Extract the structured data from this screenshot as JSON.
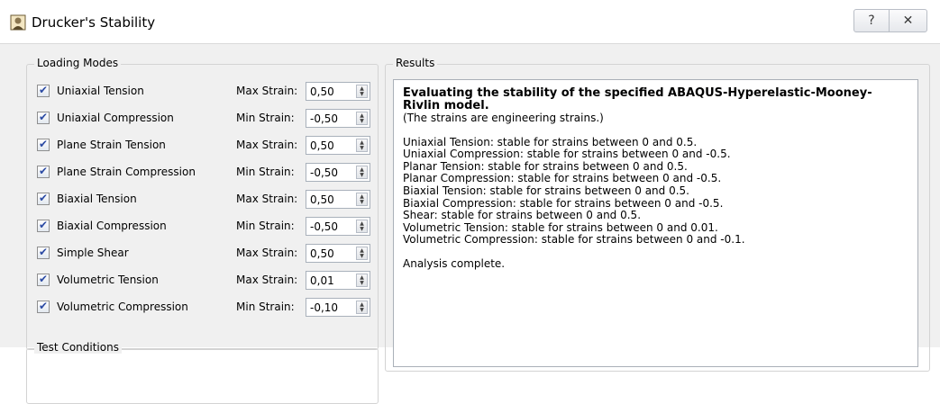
{
  "window": {
    "title": "Drucker's Stability",
    "help_label": "?",
    "close_label": "✕"
  },
  "loading_modes": {
    "title": "Loading Modes",
    "rows": [
      {
        "label": "Uniaxial Tension",
        "checked": true,
        "strain_label": "Max Strain:",
        "value": "0,50"
      },
      {
        "label": "Uniaxial Compression",
        "checked": true,
        "strain_label": "Min Strain:",
        "value": "-0,50"
      },
      {
        "label": "Plane Strain Tension",
        "checked": true,
        "strain_label": "Max Strain:",
        "value": "0,50"
      },
      {
        "label": "Plane Strain Compression",
        "checked": true,
        "strain_label": "Min Strain:",
        "value": "-0,50"
      },
      {
        "label": "Biaxial Tension",
        "checked": true,
        "strain_label": "Max Strain:",
        "value": "0,50"
      },
      {
        "label": "Biaxial Compression",
        "checked": true,
        "strain_label": "Min Strain:",
        "value": "-0,50"
      },
      {
        "label": "Simple Shear",
        "checked": true,
        "strain_label": "Max Strain:",
        "value": "0,50"
      },
      {
        "label": "Volumetric Tension",
        "checked": true,
        "strain_label": "Max Strain:",
        "value": "0,01"
      },
      {
        "label": "Volumetric Compression",
        "checked": true,
        "strain_label": "Min Strain:",
        "value": "-0,10"
      }
    ]
  },
  "test_conditions": {
    "title": "Test Conditions"
  },
  "results": {
    "title": "Results",
    "heading": "Evaluating the stability of the specified ABAQUS-Hyperelastic-Mooney-Rivlin model.",
    "note": "(The strains are engineering strains.)",
    "lines": [
      "Uniaxial Tension: stable for strains between 0 and 0.5.",
      "Uniaxial Compression: stable for strains between 0 and -0.5.",
      "Planar Tension: stable for strains between 0 and 0.5.",
      "Planar Compression: stable for strains between 0 and -0.5.",
      "Biaxial Tension: stable for strains between 0 and 0.5.",
      "Biaxial Compression: stable for strains between 0 and -0.5.",
      "Shear: stable for strains between 0 and 0.5.",
      "Volumetric Tension: stable for strains between 0 and 0.01.",
      "Volumetric Compression: stable for strains between 0 and -0.1."
    ],
    "footer": "Analysis complete."
  }
}
